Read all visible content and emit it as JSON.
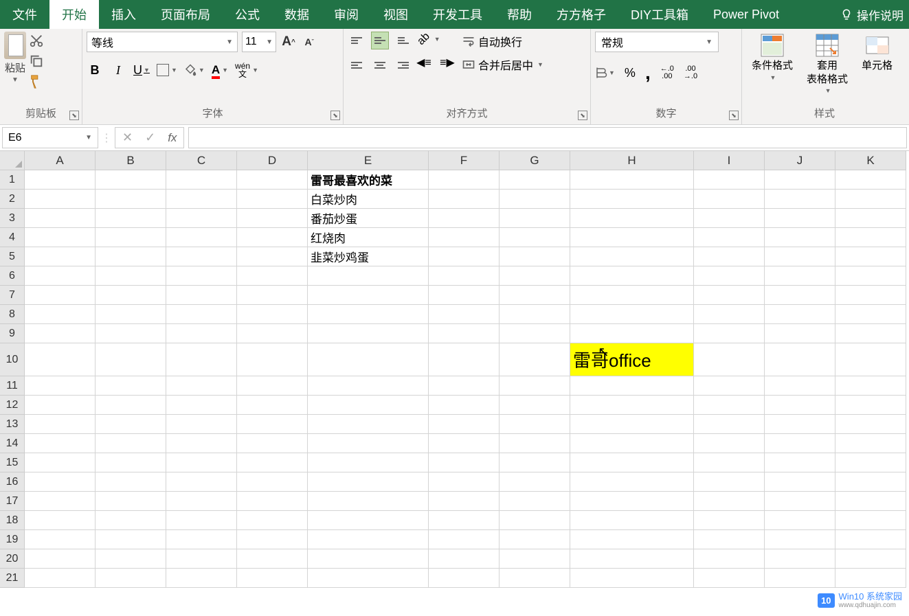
{
  "tabs": {
    "file": "文件",
    "home": "开始",
    "insert": "插入",
    "page_layout": "页面布局",
    "formulas": "公式",
    "data": "数据",
    "review": "审阅",
    "view": "视图",
    "developer": "开发工具",
    "help": "帮助",
    "ffgz": "方方格子",
    "diy": "DIY工具箱",
    "powerpivot": "Power Pivot",
    "tell_me": "操作说明"
  },
  "ribbon": {
    "clipboard": {
      "paste": "粘贴",
      "label": "剪贴板"
    },
    "font": {
      "name": "等线",
      "size": "11",
      "grow": "A",
      "shrink": "A",
      "bold": "B",
      "italic": "I",
      "underline": "U",
      "phonetic_top": "wén",
      "phonetic_bottom": "文",
      "label": "字体"
    },
    "alignment": {
      "wrap": "自动换行",
      "merge": "合并后居中",
      "label": "对齐方式"
    },
    "number": {
      "format": "常规",
      "percent": "%",
      "comma": ",",
      "inc": ".0",
      "inc2": ".00",
      "dec": ".00",
      "dec2": ".0",
      "label": "数字"
    },
    "styles": {
      "conditional": "条件格式",
      "table": "套用\n表格格式",
      "cell": "单元格",
      "label": "样式"
    }
  },
  "formula_bar": {
    "name_box": "E6",
    "cancel": "✕",
    "enter": "✓",
    "fx": "fx",
    "formula": ""
  },
  "columns": [
    "A",
    "B",
    "C",
    "D",
    "E",
    "F",
    "G",
    "H",
    "I",
    "J",
    "K"
  ],
  "rows": [
    "1",
    "2",
    "3",
    "4",
    "5",
    "6",
    "7",
    "8",
    "9",
    "10",
    "11",
    "12",
    "13",
    "14",
    "15",
    "16",
    "17",
    "18",
    "19",
    "20",
    "21"
  ],
  "cells": {
    "E1": "雷哥最喜欢的菜",
    "E2": "白菜炒肉",
    "E3": "番茄炒蛋",
    "E4": "红烧肉",
    "E5": "韭菜炒鸡蛋",
    "H10": "雷哥office"
  },
  "watermark": {
    "badge": "10",
    "title": "Win10 系统家园",
    "url": "www.qdhuajin.com"
  }
}
